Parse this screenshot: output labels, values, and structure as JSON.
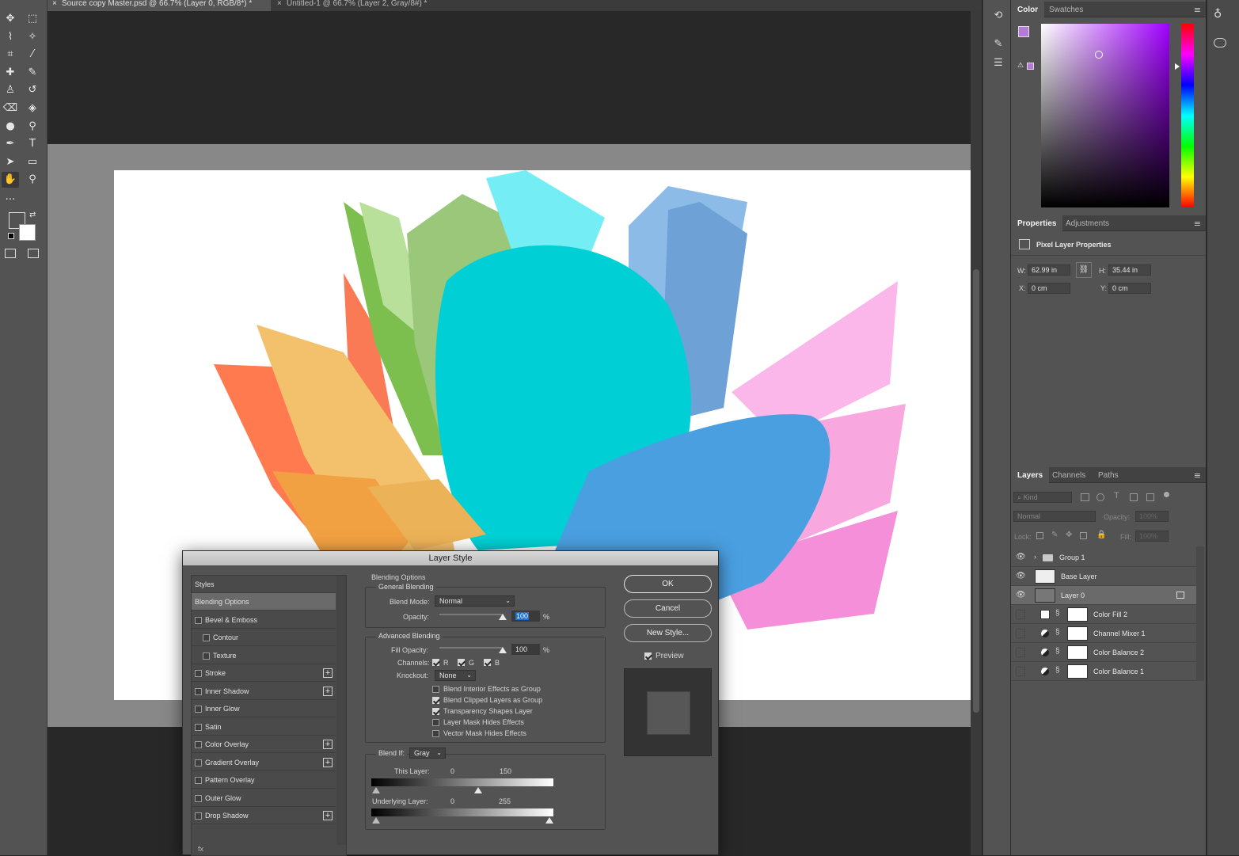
{
  "document_tabs": [
    {
      "label": "Source copy Master.psd @ 66.7% (Layer 0, RGB/8*) *",
      "close": "×"
    },
    {
      "label": "Untitled-1 @ 66.7% (Layer 2, Gray/8#) *",
      "close": "×"
    }
  ],
  "tools": [
    {
      "name": "move-tool",
      "glyph": "✥"
    },
    {
      "name": "marquee-tool",
      "glyph": "⬚"
    },
    {
      "name": "lasso-tool",
      "glyph": "⌇"
    },
    {
      "name": "magic-wand-tool",
      "glyph": "✧"
    },
    {
      "name": "crop-tool",
      "glyph": "⌗"
    },
    {
      "name": "eyedropper-tool",
      "glyph": "⁄"
    },
    {
      "name": "healing-tool",
      "glyph": "✚"
    },
    {
      "name": "brush-tool",
      "glyph": "✎"
    },
    {
      "name": "stamp-tool",
      "glyph": "♙"
    },
    {
      "name": "history-brush-tool",
      "glyph": "↺"
    },
    {
      "name": "eraser-tool",
      "glyph": "⌫"
    },
    {
      "name": "paint-bucket-tool",
      "glyph": "◈"
    },
    {
      "name": "blur-tool",
      "glyph": "●"
    },
    {
      "name": "dodge-tool",
      "glyph": "⚲"
    },
    {
      "name": "pen-tool",
      "glyph": "✒"
    },
    {
      "name": "type-tool",
      "glyph": "T"
    },
    {
      "name": "path-select-tool",
      "glyph": "➤"
    },
    {
      "name": "rectangle-tool",
      "glyph": "▭"
    },
    {
      "name": "hand-tool",
      "glyph": "✋"
    },
    {
      "name": "zoom-tool",
      "glyph": "⚲"
    },
    {
      "name": "more-tools",
      "glyph": "…"
    }
  ],
  "colors": {
    "foreground": "#b57ad8",
    "background": "#ffffff",
    "accent": "#1f6fd0"
  },
  "color_panel": {
    "tabs": [
      "Color",
      "Swatches"
    ],
    "hue": "#a000ff"
  },
  "properties_panel": {
    "tabs": [
      "Properties",
      "Adjustments"
    ],
    "title": "Pixel Layer Properties",
    "w_label": "W:",
    "w_value": "62.99 in",
    "h_label": "H:",
    "h_value": "35.44 in",
    "x_label": "X:",
    "x_value": "0 cm",
    "y_label": "Y:",
    "y_value": "0 cm"
  },
  "layers_panel": {
    "tabs": [
      "Layers",
      "Channels",
      "Paths"
    ],
    "kind_filter": "Kind",
    "blend_mode": "Normal",
    "opacity_label": "Opacity:",
    "opacity_value": "100%",
    "lock_label": "Lock:",
    "fill_label": "Fill:",
    "fill_value": "100%",
    "layers": [
      {
        "name": "Group 1",
        "visible": true,
        "type": "group"
      },
      {
        "name": "Base Layer",
        "visible": true,
        "type": "pixel"
      },
      {
        "name": "Layer 0",
        "visible": true,
        "type": "pixel",
        "selected": true
      },
      {
        "name": "Color Fill 2",
        "visible": false,
        "type": "fill"
      },
      {
        "name": "Channel Mixer 1",
        "visible": false,
        "type": "adjustment"
      },
      {
        "name": "Color Balance 2",
        "visible": false,
        "type": "adjustment"
      },
      {
        "name": "Color Balance 1",
        "visible": false,
        "type": "adjustment"
      }
    ]
  },
  "dialog": {
    "title": "Layer Style",
    "styles_header": "Styles",
    "styles": [
      {
        "label": "Blending Options",
        "checkbox": false,
        "plus": false,
        "selected": true
      },
      {
        "label": "Bevel & Emboss",
        "checkbox": true,
        "plus": false
      },
      {
        "label": "Contour",
        "checkbox": true,
        "plus": false,
        "indent": true
      },
      {
        "label": "Texture",
        "checkbox": true,
        "plus": false,
        "indent": true
      },
      {
        "label": "Stroke",
        "checkbox": true,
        "plus": true
      },
      {
        "label": "Inner Shadow",
        "checkbox": true,
        "plus": true
      },
      {
        "label": "Inner Glow",
        "checkbox": true,
        "plus": false
      },
      {
        "label": "Satin",
        "checkbox": true,
        "plus": false
      },
      {
        "label": "Color Overlay",
        "checkbox": true,
        "plus": true
      },
      {
        "label": "Gradient Overlay",
        "checkbox": true,
        "plus": true
      },
      {
        "label": "Pattern Overlay",
        "checkbox": true,
        "plus": false
      },
      {
        "label": "Outer Glow",
        "checkbox": true,
        "plus": false
      },
      {
        "label": "Drop Shadow",
        "checkbox": true,
        "plus": true
      }
    ],
    "footer_fx": "fx",
    "blending_options_title": "Blending Options",
    "general_blending": "General Blending",
    "blend_mode_label": "Blend Mode:",
    "blend_mode_value": "Normal",
    "opacity_label": "Opacity:",
    "opacity_value": "100",
    "percent": "%",
    "opacity_fraction": 1.0,
    "advanced_blending": "Advanced Blending",
    "fill_opacity_label": "Fill Opacity:",
    "fill_opacity_value": "100",
    "fill_opacity_fraction": 1.0,
    "channels_label": "Channels:",
    "channels": [
      {
        "label": "R",
        "checked": true
      },
      {
        "label": "G",
        "checked": true
      },
      {
        "label": "B",
        "checked": true
      }
    ],
    "knockout_label": "Knockout:",
    "knockout_value": "None",
    "options": [
      {
        "label": "Blend Interior Effects as Group",
        "checked": false
      },
      {
        "label": "Blend Clipped Layers as Group",
        "checked": true
      },
      {
        "label": "Transparency Shapes Layer",
        "checked": true
      },
      {
        "label": "Layer Mask Hides Effects",
        "checked": false
      },
      {
        "label": "Vector Mask Hides Effects",
        "checked": false
      }
    ],
    "blend_if_label": "Blend If:",
    "blend_if_value": "Gray",
    "this_layer_label": "This Layer:",
    "this_layer_low": "0",
    "this_layer_high": "150",
    "this_layer_high_fraction": 0.588,
    "underlying_label": "Underlying Layer:",
    "underlying_low": "0",
    "underlying_high": "255",
    "ok": "OK",
    "cancel": "Cancel",
    "new_style": "New Style...",
    "preview_label": "Preview",
    "preview_checked": true
  }
}
